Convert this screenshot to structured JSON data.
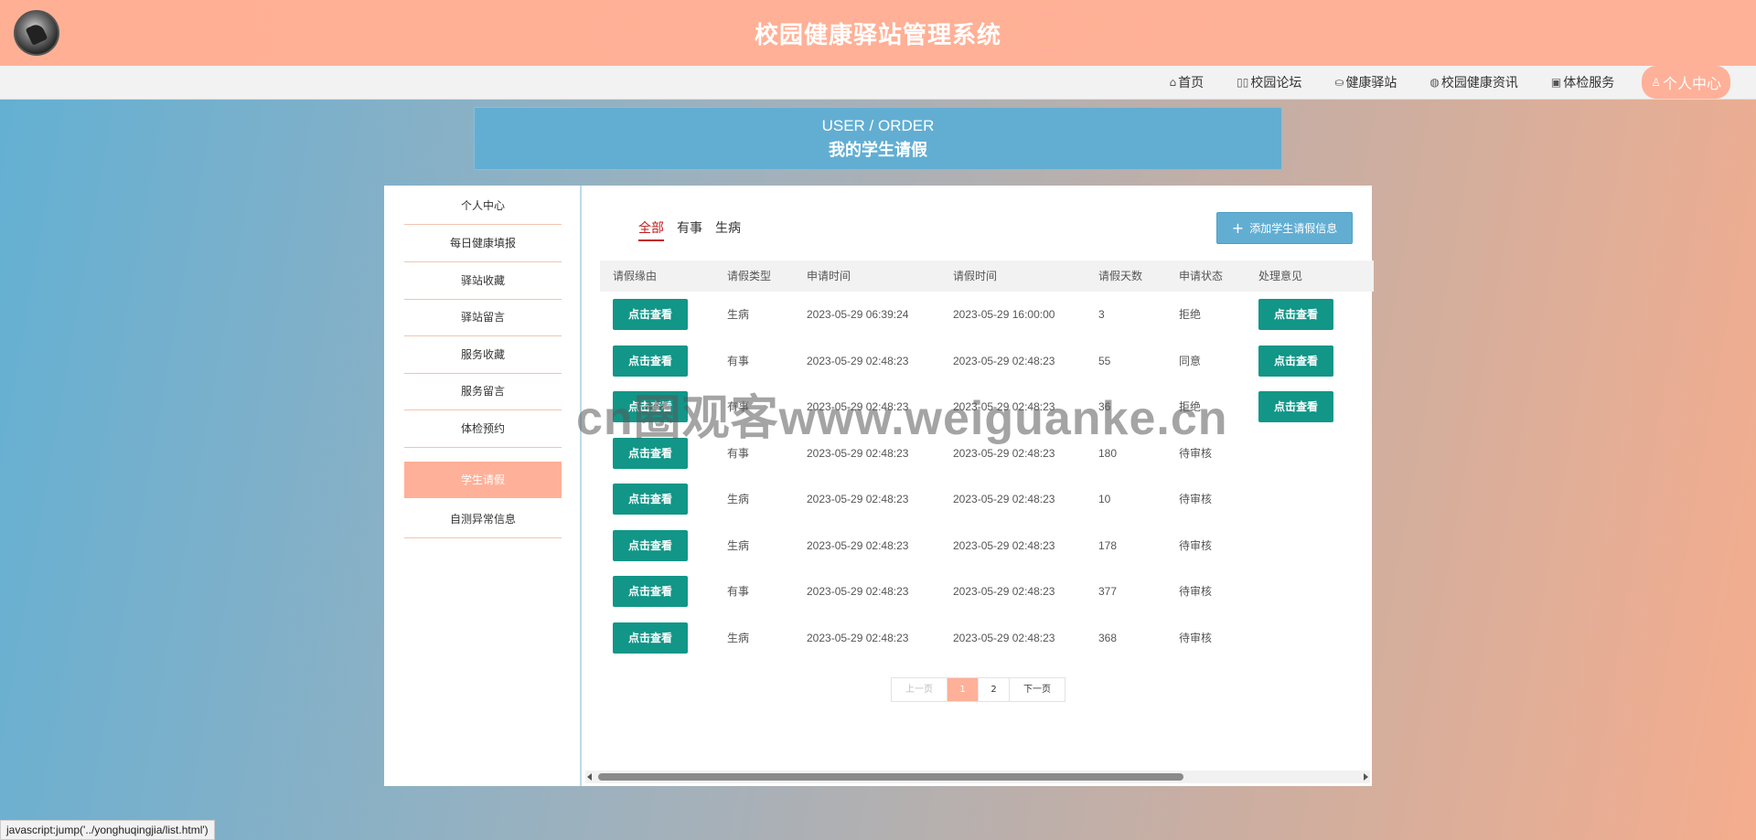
{
  "header": {
    "title": "校园健康驿站管理系统",
    "logo": "logo-avatar"
  },
  "nav": {
    "items": [
      {
        "label": "首页",
        "icon": "home-icon",
        "glyph": "⌂"
      },
      {
        "label": "校园论坛",
        "icon": "forum-icon",
        "glyph": "▯▯"
      },
      {
        "label": "健康驿站",
        "icon": "station-icon",
        "glyph": "⛀"
      },
      {
        "label": "校园健康资讯",
        "icon": "globe-icon",
        "glyph": "◍"
      },
      {
        "label": "体检服务",
        "icon": "service-icon",
        "glyph": "▣"
      }
    ],
    "active": {
      "label": "个人中心",
      "icon": "user-icon",
      "glyph": "♙"
    }
  },
  "breadcrumb": {
    "en": "USER / ORDER",
    "cn": "我的学生请假"
  },
  "sidebar": {
    "items": [
      {
        "label": "个人中心"
      },
      {
        "label": "每日健康填报"
      },
      {
        "label": "驿站收藏"
      },
      {
        "label": "驿站留言"
      },
      {
        "label": "服务收藏"
      },
      {
        "label": "服务留言"
      },
      {
        "label": "体检预约"
      },
      {
        "label": "学生请假"
      },
      {
        "label": "自测异常信息"
      }
    ],
    "active_index": 7
  },
  "tabs": [
    {
      "label": "全部"
    },
    {
      "label": "有事"
    },
    {
      "label": "生病"
    }
  ],
  "add_button": {
    "label": "添加学生请假信息",
    "icon": "plus-icon"
  },
  "table": {
    "headers": [
      "请假缘由",
      "请假类型",
      "申请时间",
      "请假时间",
      "请假天数",
      "申请状态",
      "处理意见"
    ],
    "view_label": "点击查看",
    "rows": [
      {
        "type": "生病",
        "apply_time": "2023-05-29 06:39:24",
        "leave_time": "2023-05-29 16:00:00",
        "days": "3",
        "status": "拒绝",
        "has_opinion": true
      },
      {
        "type": "有事",
        "apply_time": "2023-05-29 02:48:23",
        "leave_time": "2023-05-29 02:48:23",
        "days": "55",
        "status": "同意",
        "has_opinion": true
      },
      {
        "type": "有事",
        "apply_time": "2023-05-29 02:48:23",
        "leave_time": "2023-05-29 02:48:23",
        "days": "36",
        "status": "拒绝",
        "has_opinion": true
      },
      {
        "type": "有事",
        "apply_time": "2023-05-29 02:48:23",
        "leave_time": "2023-05-29 02:48:23",
        "days": "180",
        "status": "待审核",
        "has_opinion": false
      },
      {
        "type": "生病",
        "apply_time": "2023-05-29 02:48:23",
        "leave_time": "2023-05-29 02:48:23",
        "days": "10",
        "status": "待审核",
        "has_opinion": false
      },
      {
        "type": "生病",
        "apply_time": "2023-05-29 02:48:23",
        "leave_time": "2023-05-29 02:48:23",
        "days": "178",
        "status": "待审核",
        "has_opinion": false
      },
      {
        "type": "有事",
        "apply_time": "2023-05-29 02:48:23",
        "leave_time": "2023-05-29 02:48:23",
        "days": "377",
        "status": "待审核",
        "has_opinion": false
      },
      {
        "type": "生病",
        "apply_time": "2023-05-29 02:48:23",
        "leave_time": "2023-05-29 02:48:23",
        "days": "368",
        "status": "待审核",
        "has_opinion": false
      }
    ]
  },
  "pager": {
    "prev": "上一页",
    "pages": [
      "1",
      "2"
    ],
    "current": "1",
    "next": "下一页"
  },
  "watermark": "cn圈观客www.weiguanke.cn",
  "status_url": "javascript:jump('../yonghuqingjia/list.html')"
}
